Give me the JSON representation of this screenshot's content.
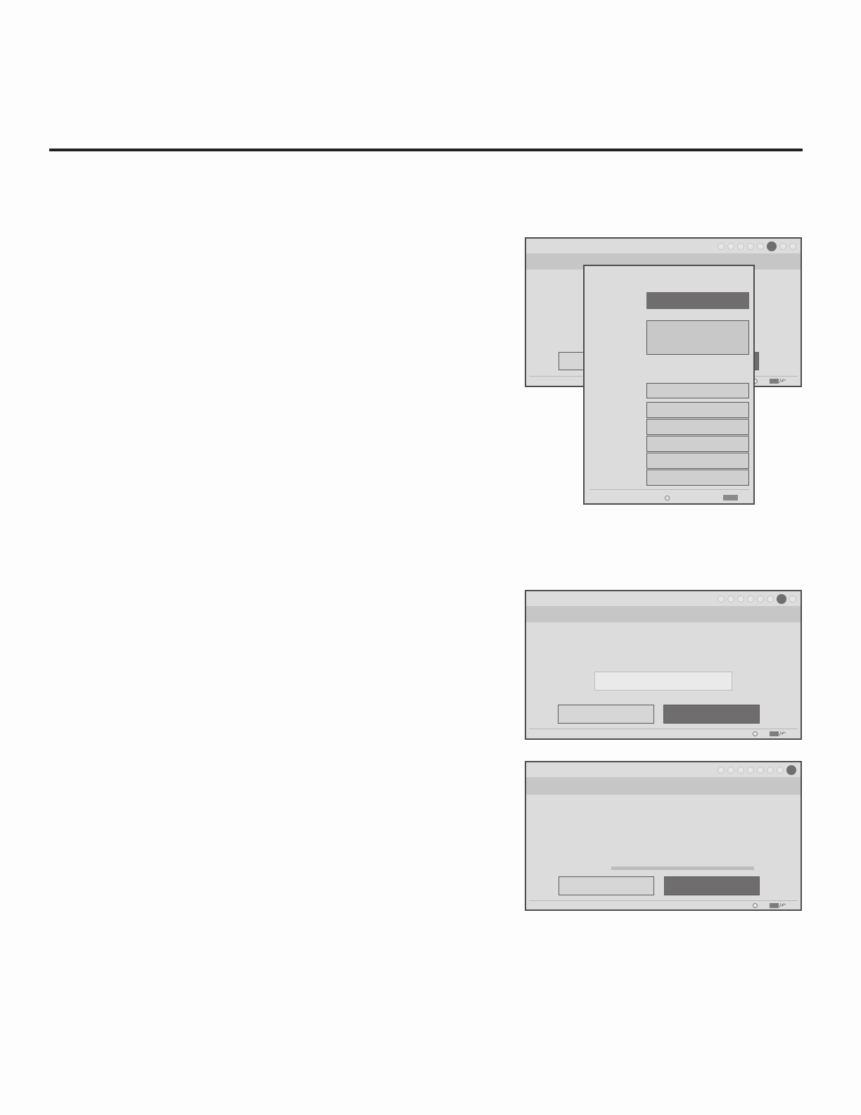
{
  "page": {},
  "screens": [
    {
      "id": "screen-1",
      "steps": 8,
      "active_step": 6
    },
    {
      "id": "screen-2",
      "steps": 8,
      "active_step": 7
    },
    {
      "id": "screen-3",
      "steps": 8,
      "active_step": 8
    }
  ],
  "progress": {
    "value": 1.0
  },
  "icons": {
    "nav": "navigation-icon",
    "back": "back-arrow-icon",
    "exit": "exit-key-icon"
  },
  "colors": {
    "screen_bg": "#dcdcdc",
    "band": "#c6c6c6",
    "selected": "#6f6d6e",
    "rule": "#231f20"
  }
}
